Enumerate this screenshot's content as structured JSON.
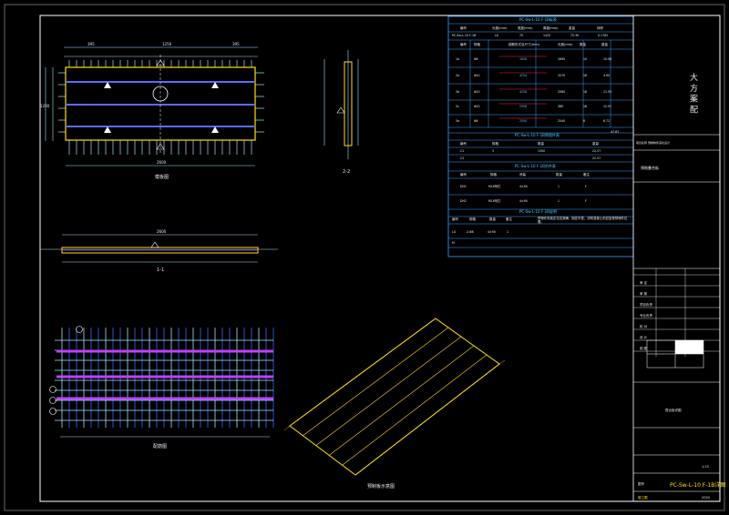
{
  "colors": {
    "background": "#000000",
    "frame": "#ffffff",
    "panel": "#ffe000",
    "rebar_blue": "#3a6bff",
    "rebar_cyan": "#9be7ff",
    "rebar_magenta": "#c040ff",
    "table_line": "#3aa0ff",
    "highlight_red": "#ff2050"
  },
  "drawings": {
    "plan_label": "模板图",
    "section_1_label": "1-1",
    "section_2_label": "2-2",
    "rebar_plan_label": "配筋图",
    "iso_label": "预制板示意图",
    "dim_top": [
      "395",
      "1250",
      "395"
    ],
    "dim_bottom": "2600",
    "dim_left": "1200",
    "dim_section": "2600"
  },
  "tables": {
    "plank_table": {
      "title": "PC-Sw-L-10 F-1B板表",
      "headers": [
        "编号",
        "长度(mm)",
        "宽度(mm)",
        "厚度(mm)",
        "重量",
        "体积"
      ],
      "rows": [
        [
          "PC-Sw-L-10 F-1B",
          "L6",
          "70",
          "1420",
          "75.30",
          "0.1762"
        ]
      ]
    },
    "rebar_table": {
      "headers": [
        "编号",
        "规格",
        "钢筋形式及尺寸(mm)",
        "长度(mm)",
        "数量",
        "重量"
      ],
      "rows": [
        [
          "1a",
          "Φ8",
          "1626",
          "1690",
          "10",
          "10.98"
        ],
        [
          "2a",
          "Φ10",
          "4254",
          "3270",
          "18",
          "4.90"
        ],
        [
          "2b",
          "Φ10",
          "4258",
          "2080",
          "18",
          "11.95"
        ],
        [
          "2c",
          "Φ10",
          "2558",
          "380",
          "18",
          "12.91"
        ],
        [
          "3a",
          "Φ8",
          "2500",
          "2540",
          "8",
          "6.72"
        ]
      ],
      "total": "47.67"
    },
    "embed_table": {
      "title": "PC-Sw-L-10 F-1B预埋件表",
      "headers": [
        "编号",
        "规格",
        "数量",
        "重量"
      ],
      "rows": [
        [
          "C1",
          "3",
          "1300",
          "22.57"
        ],
        [
          "C2",
          "",
          "",
          "22.57"
        ]
      ]
    },
    "lift_table": {
      "title": "PC-Sw-L-10 F-1B吊件表",
      "headers": [
        "编号",
        "规格",
        "吊装",
        "数量",
        "备注"
      ],
      "rows": [
        [
          "DH1",
          "M16吊钉",
          "4×90",
          "1",
          "F"
        ],
        [
          "DH2",
          "M16吊钉",
          "4×90",
          "1",
          "F"
        ]
      ]
    },
    "note_table": {
      "title": "PC-Sw-L-10 F-1B说明",
      "headers": [
        "编号",
        "规格",
        "数量",
        "备注"
      ],
      "rows": [
        [
          "LG",
          "2-Φ8",
          "4×90",
          "1"
        ],
        [
          "M",
          "",
          "",
          ""
        ]
      ],
      "note": "预埋件安装定位应准确，固定牢靠，浇筑混凝土前应复核预埋件位置。"
    }
  },
  "title_block": {
    "project": "大 方 案 配",
    "design_note": "项目名称 预制构件深化设计",
    "subproject": "预制叠合板",
    "rows": [
      "审 定",
      "审 核",
      "项目负责",
      "专业负责",
      "校 对",
      "设 计",
      "制 图"
    ],
    "drawing_title": "叠合板详图",
    "sheet_no_label": "图号",
    "drawing_number": "PC-Sw-L-10 F-1B详图",
    "scale": "1:25",
    "date": "2020",
    "stage": "施工图"
  }
}
